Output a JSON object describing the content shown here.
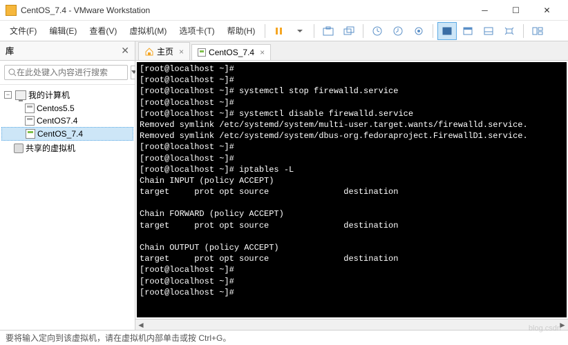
{
  "window": {
    "title": "CentOS_7.4 - VMware Workstation"
  },
  "menu": {
    "file": "文件(F)",
    "edit": "编辑(E)",
    "view": "查看(V)",
    "vm": "虚拟机(M)",
    "tabs": "选项卡(T)",
    "help": "帮助(H)"
  },
  "sidebar": {
    "title": "库",
    "search_placeholder": "在此处键入内容进行搜索",
    "root": "我的计算机",
    "items": [
      {
        "label": "Centos5.5"
      },
      {
        "label": "CentOS7.4"
      },
      {
        "label": "CentOS_7.4"
      }
    ],
    "shared": "共享的虚拟机"
  },
  "tabs": {
    "home": "主页",
    "vm": "CentOS_7.4"
  },
  "terminal": {
    "lines": [
      "[root@localhost ~]#",
      "[root@localhost ~]#",
      "[root@localhost ~]# systemctl stop firewalld.service",
      "[root@localhost ~]#",
      "[root@localhost ~]# systemctl disable firewalld.service",
      "Removed symlink /etc/systemd/system/multi-user.target.wants/firewalld.service.",
      "Removed symlink /etc/systemd/system/dbus-org.fedoraproject.FirewallD1.service.",
      "[root@localhost ~]#",
      "[root@localhost ~]#",
      "[root@localhost ~]# iptables -L",
      "Chain INPUT (policy ACCEPT)",
      "target     prot opt source               destination",
      "",
      "Chain FORWARD (policy ACCEPT)",
      "target     prot opt source               destination",
      "",
      "Chain OUTPUT (policy ACCEPT)",
      "target     prot opt source               destination",
      "[root@localhost ~]#",
      "[root@localhost ~]#",
      "[root@localhost ~]#"
    ]
  },
  "statusbar": {
    "text": "要将输入定向到该虚拟机，请在虚拟机内部单击或按 Ctrl+G。"
  },
  "watermark": "blog.csdn"
}
